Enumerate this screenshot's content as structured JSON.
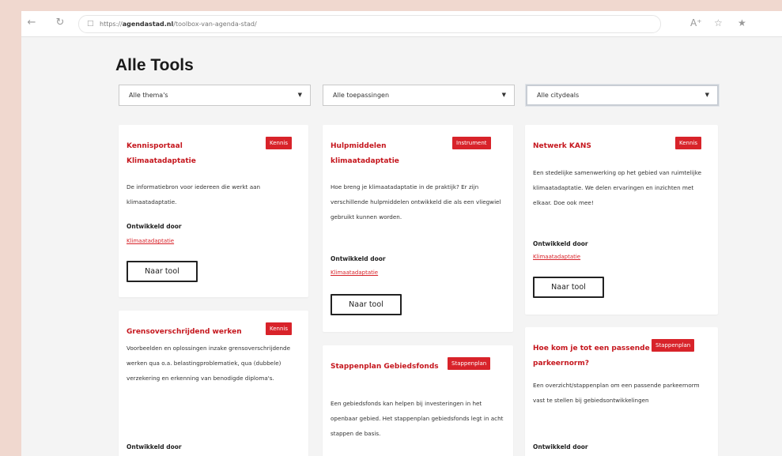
{
  "browser": {
    "back_icon": "arrow-left",
    "reload_icon": "reload",
    "url_prefix": "https://",
    "url_domain": "agendastad.nl",
    "url_path": "/toolbox-van-agenda-stad/"
  },
  "page": {
    "title": "Alle Tools",
    "filters": [
      {
        "label": "Alle thema's"
      },
      {
        "label": "Alle toepassingen"
      },
      {
        "label": "Alle citydeals"
      }
    ]
  },
  "cards": [
    {
      "title": "Kennisportaal Klimaatadaptatie",
      "badge": "Kennis",
      "description": "De informatiebron voor iedereen die werkt aan klimaatadaptatie.",
      "developed_label": "Ontwikkeld door",
      "developer": "Klimaatadaptatie",
      "button": "Naar tool"
    },
    {
      "title": "Hulpmiddelen klimaatadaptatie",
      "badge": "Instrument",
      "description": "Hoe breng je klimaatadaptatie in de praktijk? Er zijn verschillende hulpmiddelen ontwikkeld die als een vliegwiel gebruikt kunnen worden.",
      "developed_label": "Ontwikkeld door",
      "developer": "Klimaatadaptatie",
      "button": "Naar tool"
    },
    {
      "title": "Netwerk KANS",
      "badge": "Kennis",
      "description": "Een stedelijke samenwerking op het gebied van ruimtelijke klimaatadaptatie. We delen ervaringen en inzichten met elkaar. Doe ook mee!",
      "developed_label": "Ontwikkeld door",
      "developer": "Klimaatadaptatie",
      "button": "Naar tool"
    },
    {
      "title": "Grensoverschrijdend werken",
      "badge": "Kennis",
      "description": "Voorbeelden en oplossingen inzake grensoverschrijdende werken qua o.a. belastingproblematiek, qua (dubbele) verzekering en erkenning van benodigde diploma's.",
      "developed_label": "Ontwikkeld door"
    },
    {
      "title": "Stappenplan Gebiedsfonds",
      "badge": "Stappenplan",
      "description": "Een gebiedsfonds kan helpen bij investeringen in het openbaar gebied. Het stappenplan gebiedsfonds legt in acht stappen de basis."
    },
    {
      "title": "Hoe kom je tot een passende parkeernorm?",
      "badge": "Stappenplan",
      "description": "Een overzicht/stappenplan om een passende parkeernorm vast te stellen bij gebiedsontwikkelingen",
      "developed_label": "Ontwikkeld door"
    }
  ]
}
